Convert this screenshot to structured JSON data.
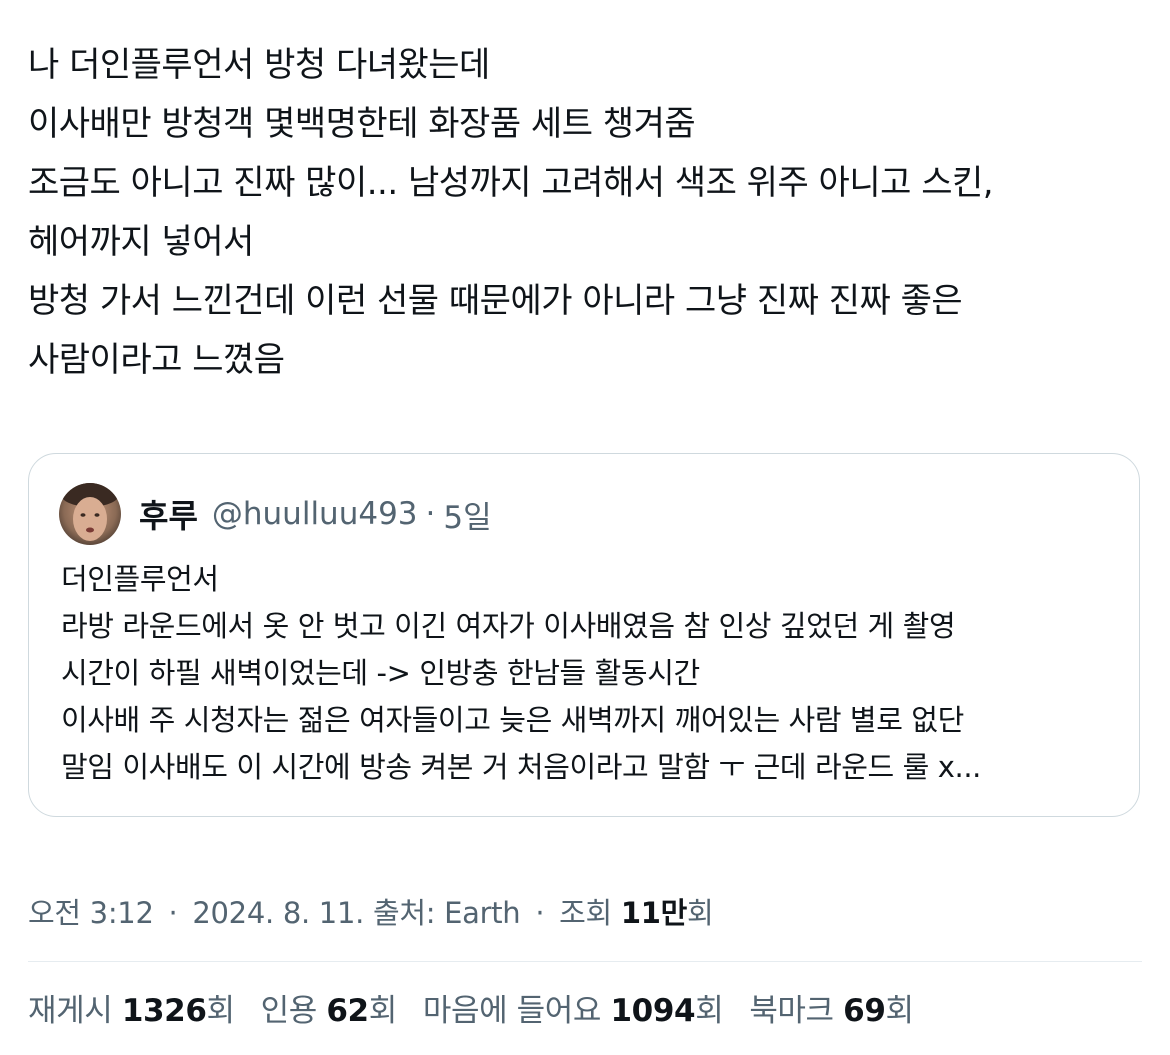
{
  "tweet": {
    "lines": [
      "나 더인플루언서 방청 다녀왔는데",
      "이사배만 방청객 몇백명한테 화장품 세트 챙겨줌",
      "조금도 아니고 진짜 많이... 남성까지 고려해서 색조 위주 아니고 스킨,",
      "헤어까지 넣어서",
      "방청 가서 느낀건데 이런 선물 때문에가 아니라 그냥 진짜 진짜 좋은",
      "사람이라고 느꼈음"
    ]
  },
  "quote": {
    "name": "후루",
    "handle": "@huulluu493",
    "separator": "·",
    "time": "5일",
    "avatar_icon": "user-avatar",
    "lines": [
      "더인플루언서",
      "라방 라운드에서 옷 안 벗고 이긴 여자가 이사배였음 참 인상 깊었던 게 촬영",
      "시간이 하필 새벽이었는데 -> 인방충 한남들 활동시간",
      "이사배 주 시청자는 젊은 여자들이고 늦은 새벽까지 깨어있는 사람 별로 없단",
      "말임 이사배도 이 시간에 방송 켜본 거 처음이라고 말함 ㅜ 근데 라운드 룰 x..."
    ]
  },
  "meta": {
    "time": "오전 3:12",
    "date": "2024. 8. 11.",
    "source_label": "출처:",
    "source": "Earth",
    "views_label": "조회",
    "views_value": "11만",
    "views_suffix": "회",
    "separator": "·"
  },
  "stats": [
    {
      "label": "재게시",
      "value": "1326",
      "suffix": "회"
    },
    {
      "label": "인용",
      "value": "62",
      "suffix": "회"
    },
    {
      "label": "마음에 들어요",
      "value": "1094",
      "suffix": "회"
    },
    {
      "label": "북마크",
      "value": "69",
      "suffix": "회"
    }
  ],
  "colors": {
    "text": "#0f1419",
    "secondary": "#536471",
    "border": "#cfd9de",
    "divider": "#e6ecf0"
  }
}
